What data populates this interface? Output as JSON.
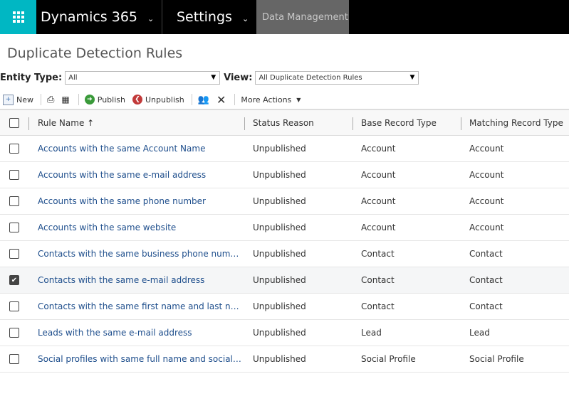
{
  "topbar": {
    "app_name": "Dynamics 365",
    "area": "Settings",
    "breadcrumb": "Data Management",
    "waffle_color": "#00b7c3"
  },
  "page": {
    "title": "Duplicate Detection Rules"
  },
  "filters": {
    "entity_type_label": "Entity Type:",
    "entity_type_value": "All",
    "view_label": "View:",
    "view_value": "All Duplicate Detection Rules"
  },
  "toolbar": {
    "new": "New",
    "publish": "Publish",
    "unpublish": "Unpublish",
    "more_actions": "More Actions"
  },
  "grid": {
    "columns": [
      "Rule Name ↑",
      "Status Reason",
      "Base Record Type",
      "Matching Record Type"
    ],
    "rows": [
      {
        "name": "Accounts with the same Account Name",
        "status": "Unpublished",
        "base": "Account",
        "matching": "Account",
        "checked": false
      },
      {
        "name": "Accounts with the same e-mail address",
        "status": "Unpublished",
        "base": "Account",
        "matching": "Account",
        "checked": false
      },
      {
        "name": "Accounts with the same phone number",
        "status": "Unpublished",
        "base": "Account",
        "matching": "Account",
        "checked": false
      },
      {
        "name": "Accounts with the same website",
        "status": "Unpublished",
        "base": "Account",
        "matching": "Account",
        "checked": false
      },
      {
        "name": "Contacts with the same business phone number",
        "status": "Unpublished",
        "base": "Contact",
        "matching": "Contact",
        "checked": false
      },
      {
        "name": "Contacts with the same e-mail address",
        "status": "Unpublished",
        "base": "Contact",
        "matching": "Contact",
        "checked": true
      },
      {
        "name": "Contacts with the same first name and last name",
        "status": "Unpublished",
        "base": "Contact",
        "matching": "Contact",
        "checked": false
      },
      {
        "name": "Leads with the same e-mail address",
        "status": "Unpublished",
        "base": "Lead",
        "matching": "Lead",
        "checked": false
      },
      {
        "name": "Social profiles with same full name and social ch...",
        "status": "Unpublished",
        "base": "Social Profile",
        "matching": "Social Profile",
        "checked": false
      }
    ]
  }
}
